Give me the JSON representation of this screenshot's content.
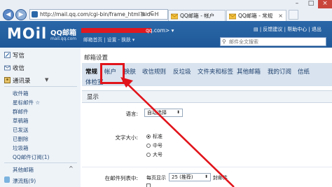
{
  "browser": {
    "url": "http://mail.qq.com/cgi-bin/frame_html?sid=H",
    "url_suffix": "ρ - C",
    "tabs": [
      {
        "label": "QQ邮箱 - 帐户"
      },
      {
        "label": "QQ邮箱 - 常规"
      }
    ]
  },
  "header": {
    "logo": "MOil",
    "logo_cn": "QQ邮箱",
    "logo_sub": "mail.qq.com",
    "account_suffix": "qq.com> ▾",
    "links": "邮箱首页 | 设置 - 换肤 ▾",
    "top_links": "▤  | 反馈建议 | 帮助中心 | 退出",
    "search_placeholder": "邮件全文搜索"
  },
  "sidebar": {
    "actions": [
      "写信",
      "收信",
      "通讯录"
    ],
    "folders": [
      "收件箱",
      "星标邮件 ☆",
      "群邮件",
      "草稿箱",
      "已发送",
      "已删除",
      "垃圾箱",
      "QQ邮件订阅(1)"
    ],
    "other_title": "其他邮箱",
    "drift": "漂流瓶(9)"
  },
  "settings": {
    "title": "邮箱设置",
    "tabs": [
      "常规",
      "帐户",
      "换肤",
      "收信规则",
      "反垃圾",
      "文件夹和标签",
      "其他邮箱",
      "我的订阅",
      "信纸",
      "体检室"
    ],
    "section": "显示",
    "language_label": "语言:",
    "language_value": "自动选择",
    "font_label": "文字大小:",
    "font_options": [
      "标准",
      "中号",
      "大号"
    ],
    "list_label": "在邮件列表中:",
    "per_page_label": "每页显示",
    "per_page_value": "25 (推荐)",
    "per_page_suffix": "封邮件"
  },
  "colors": {
    "header_blue": "#2a67a8",
    "highlight_red": "#e1141b"
  }
}
